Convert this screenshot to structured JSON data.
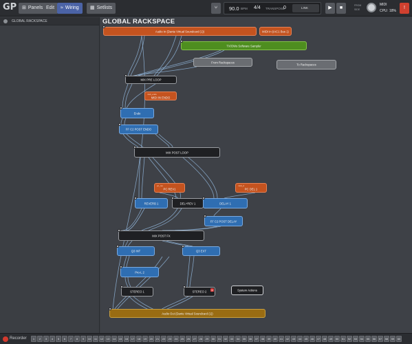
{
  "app": {
    "logo_text": "GP"
  },
  "toolbar": {
    "panels_label": "Panels",
    "edit_label": "Edit",
    "wiring_label": "Wiring",
    "setlists_label": "Setlists",
    "tempo_value": "90.0",
    "tempo_unit": "BPM",
    "time_signature": "4/4",
    "transpose_label": "TRANSPOSE",
    "transpose_value": "0",
    "link_label": "LINK",
    "midi_label": "MIDI",
    "cpu_label": "CPU:",
    "cpu_value": "18%",
    "from_label": "FROM",
    "sidebar_label": "SIDE"
  },
  "sidebar": {
    "item_label": "GLOBAL RACKSPACE"
  },
  "canvas": {
    "title": "GLOBAL RACKSPACE"
  },
  "nodes": {
    "audio_in": "Audio In (Dante Virtual Soundcard (1))",
    "midi_in_eac1": "MIDI In (IAC1 Bus 1)",
    "txs": "TX/OWs Software Sampler",
    "from_rackspaces": "From Rackspaces",
    "to_rackspaces": "To Rackspaces",
    "mix_pre_loop": "MIX PRE LOOP",
    "midi_in_endo": "MIDI IN ENDO",
    "midi_in_endo_tag": "midi_endo",
    "endo": "Endo",
    "ff_c2_post_endo": "FF C2 POST ENDO",
    "mix_post_loop": "MIX POST LOOP",
    "pc_rev1": "PC REV1",
    "pc_rev1_tag": "pc_rev",
    "pc_del1": "PC DEL 1",
    "pc_del1_tag": "midi_d",
    "reverb1": "REVERB 1",
    "del_rev1": "DEL+REV 1",
    "delay1": "DELAY 1",
    "ff_c2_post_delay": "FF C2 POST DELAY",
    "mix_post_fx": "MIX POST FX",
    "q3_int": "Q3 INT",
    "q3_ext": "Q3 EXT",
    "pro_l2": "Pro-L 2",
    "stereo1": "STEREO 1",
    "stereo2": "STEREO 2",
    "system_actions": "System Actions",
    "audio_out": "Audio Out (Dante Virtual Soundcard (1))"
  },
  "bottombar": {
    "recorder_label": "Recorder",
    "buttons": [
      "1",
      "2",
      "3",
      "4",
      "5",
      "6",
      "7",
      "8",
      "9",
      "10",
      "11",
      "12",
      "13",
      "14",
      "15",
      "16",
      "17",
      "18",
      "19",
      "20",
      "21",
      "22",
      "23",
      "24",
      "25",
      "26",
      "27",
      "28",
      "29",
      "30",
      "31",
      "32",
      "33",
      "34",
      "35",
      "36",
      "37",
      "38",
      "39",
      "40",
      "41",
      "42",
      "43",
      "44",
      "45",
      "46",
      "47",
      "48",
      "49",
      "50",
      "51",
      "52",
      "53",
      "54",
      "55",
      "56",
      "57",
      "58",
      "59",
      "60",
      "OUT"
    ]
  },
  "colors": {
    "wire": "#8fb4d8",
    "orange": "#c4531f",
    "green": "#4e8e1f",
    "blue": "#2f6eb2",
    "brown": "#9a6c12",
    "accent": "#4b63a6"
  }
}
